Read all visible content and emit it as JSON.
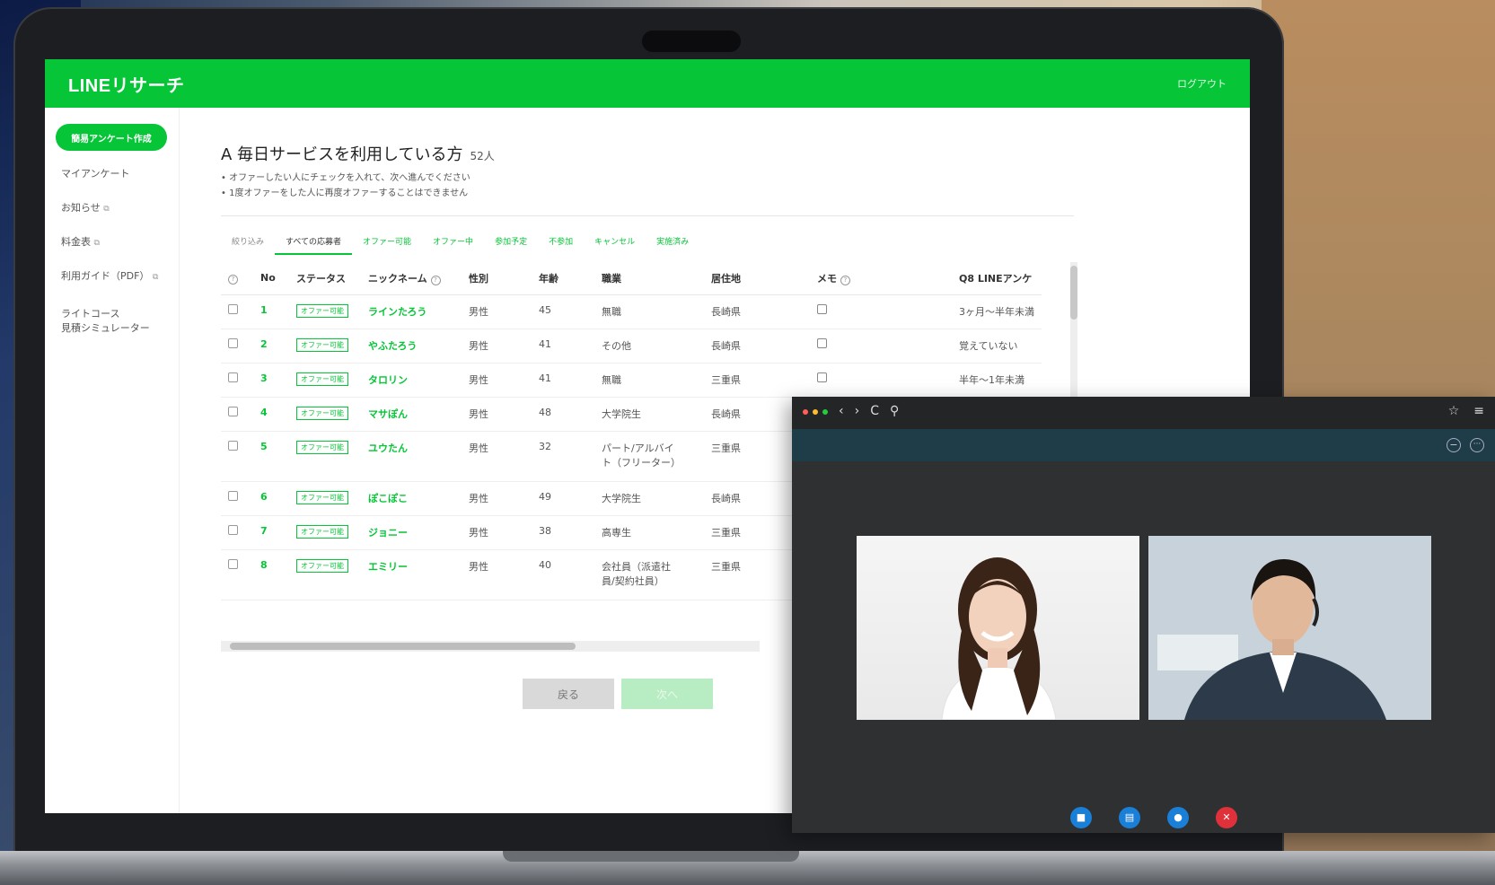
{
  "app": {
    "logo": "LINEリサーチ",
    "logout": "ログアウト"
  },
  "sidebar": {
    "create_button": "簡易アンケート作成",
    "items": [
      {
        "label": "マイアンケート"
      },
      {
        "label": "お知らせ"
      },
      {
        "label": "料金表"
      },
      {
        "label": "利用ガイド（PDF）"
      },
      {
        "label": "ライトコース"
      },
      {
        "label": "見積シミュレーター"
      }
    ]
  },
  "main": {
    "title": "A 毎日サービスを利用している方",
    "count": "52人",
    "notes": [
      "• オファーしたい人にチェックを入れて、次へ進んでください",
      "• 1度オファーをした人に再度オファーすることはできません"
    ]
  },
  "tabs": [
    "絞り込み",
    "すべての応募者",
    "オファー可能",
    "オファー中",
    "参加予定",
    "不参加",
    "キャンセル",
    "実施済み"
  ],
  "table": {
    "headers": [
      "No",
      "ステータス",
      "ニックネーム",
      "性別",
      "年齢",
      "職業",
      "居住地",
      "メモ",
      "Q8 LINEアンケ"
    ],
    "rows": [
      {
        "no": "1",
        "status": "オファー可能",
        "nick": "ラインたろう",
        "gender": "男性",
        "age": "45",
        "job": "無職",
        "job2": "",
        "area": "長崎県",
        "q8": "3ヶ月〜半年未満"
      },
      {
        "no": "2",
        "status": "オファー可能",
        "nick": "やふたろう",
        "gender": "男性",
        "age": "41",
        "job": "その他",
        "job2": "",
        "area": "長崎県",
        "q8": "覚えていない"
      },
      {
        "no": "3",
        "status": "オファー可能",
        "nick": "タロリン",
        "gender": "男性",
        "age": "41",
        "job": "無職",
        "job2": "",
        "area": "三重県",
        "q8": "半年〜1年未満"
      },
      {
        "no": "4",
        "status": "オファー可能",
        "nick": "マサぽん",
        "gender": "男性",
        "age": "48",
        "job": "大学院生",
        "job2": "",
        "area": "長崎県",
        "q8": ""
      },
      {
        "no": "5",
        "status": "オファー可能",
        "nick": "ユウたん",
        "gender": "男性",
        "age": "32",
        "job": "パート/アルバイ",
        "job2": "ト（フリーター）",
        "area": "三重県",
        "q8": ""
      },
      {
        "no": "6",
        "status": "オファー可能",
        "nick": "ぽこぽこ",
        "gender": "男性",
        "age": "49",
        "job": "大学院生",
        "job2": "",
        "area": "長崎県",
        "q8": ""
      },
      {
        "no": "7",
        "status": "オファー可能",
        "nick": "ジョニー",
        "gender": "男性",
        "age": "38",
        "job": "高専生",
        "job2": "",
        "area": "三重県",
        "q8": ""
      },
      {
        "no": "8",
        "status": "オファー可能",
        "nick": "エミリー",
        "gender": "男性",
        "age": "40",
        "job": "会社員（派遣社",
        "job2": "員/契約社員）",
        "area": "三重県",
        "q8": ""
      }
    ]
  },
  "buttons": {
    "back": "戻る",
    "next": "次へ"
  },
  "icons": {
    "external": "⧉",
    "help": "?",
    "memo": "✎"
  },
  "video_call": {
    "nav_back": "‹",
    "nav_forward": "›",
    "reload": "C",
    "search": "⚲",
    "star": "☆",
    "menu": "≡",
    "minimize": "−",
    "more": "···",
    "controls": [
      {
        "name": "camera-button",
        "glyph": "■",
        "color": "#1a7fd6"
      },
      {
        "name": "screen-share-button",
        "glyph": "▤",
        "color": "#1a7fd6"
      },
      {
        "name": "chat-button",
        "glyph": "●",
        "color": "#1a7fd6"
      },
      {
        "name": "end-call-button",
        "glyph": "✕",
        "color": "#e0303a"
      }
    ]
  },
  "colors": {
    "brand": "#06c537"
  }
}
